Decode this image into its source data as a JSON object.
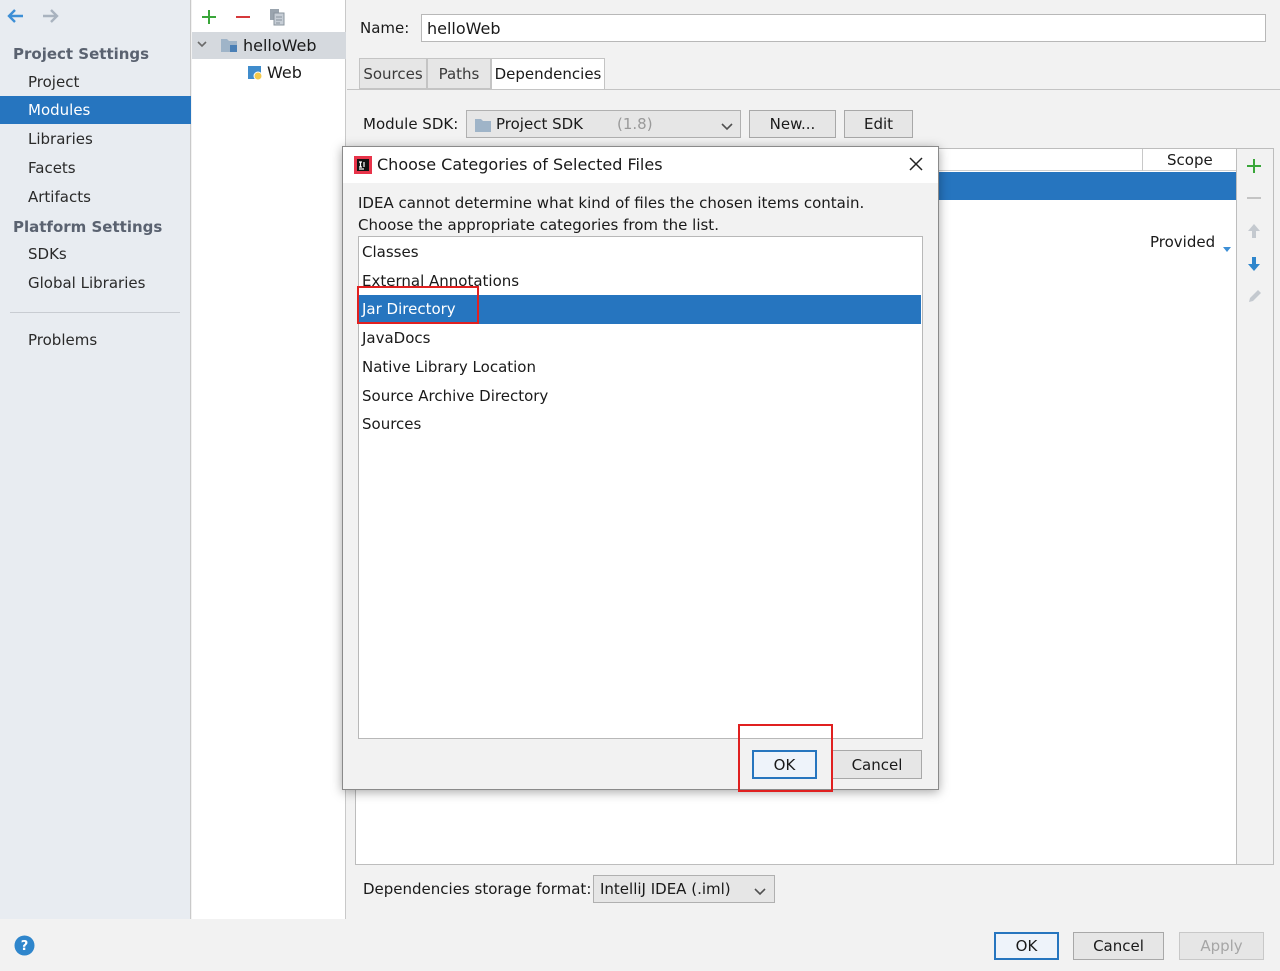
{
  "nav": {
    "back_icon": "arrow-left-icon",
    "forward_icon": "arrow-right-icon"
  },
  "sidebar": {
    "project_settings_header": "Project Settings",
    "project_items": [
      {
        "label": "Project"
      },
      {
        "label": "Modules",
        "active": true
      },
      {
        "label": "Libraries"
      },
      {
        "label": "Facets"
      },
      {
        "label": "Artifacts"
      }
    ],
    "platform_settings_header": "Platform Settings",
    "platform_items": [
      {
        "label": "SDKs"
      },
      {
        "label": "Global Libraries"
      }
    ],
    "problems_label": "Problems"
  },
  "tree": {
    "toolbar": {
      "add_icon": "plus-icon",
      "remove_icon": "minus-icon",
      "copy_icon": "copy-icon"
    },
    "root_label": "helloWeb",
    "child_label": "Web"
  },
  "module": {
    "name_label": "Name:",
    "name_value": "helloWeb",
    "tabs": [
      {
        "label": "Sources"
      },
      {
        "label": "Paths"
      },
      {
        "label": "Dependencies",
        "active": true
      }
    ],
    "sdk_label": "Module SDK:",
    "sdk_value": "Project SDK",
    "sdk_version": "(1.8)",
    "new_button": "New...",
    "edit_button": "Edit",
    "scope_header": "Scope",
    "provided_label": "Provided",
    "storage_format_label": "Dependencies storage format:",
    "storage_format_value": "IntelliJ IDEA (.iml)"
  },
  "dialog": {
    "title": "Choose Categories of Selected Files",
    "message_line1": "IDEA cannot determine what kind of files the chosen items contain.",
    "message_line2": "Choose the appropriate categories from the list.",
    "items": [
      {
        "label": "Classes"
      },
      {
        "label": "External Annotations"
      },
      {
        "label": "Jar Directory",
        "selected": true
      },
      {
        "label": "JavaDocs"
      },
      {
        "label": "Native Library Location"
      },
      {
        "label": "Source Archive Directory"
      },
      {
        "label": "Sources"
      }
    ],
    "ok_button": "OK",
    "cancel_button": "Cancel"
  },
  "footer": {
    "ok_button": "OK",
    "cancel_button": "Cancel",
    "apply_button": "Apply"
  },
  "colors": {
    "accent": "#2675bf",
    "highlight_box": "#e02020",
    "add_green": "#3aa63a",
    "remove_red": "#d6393b"
  }
}
